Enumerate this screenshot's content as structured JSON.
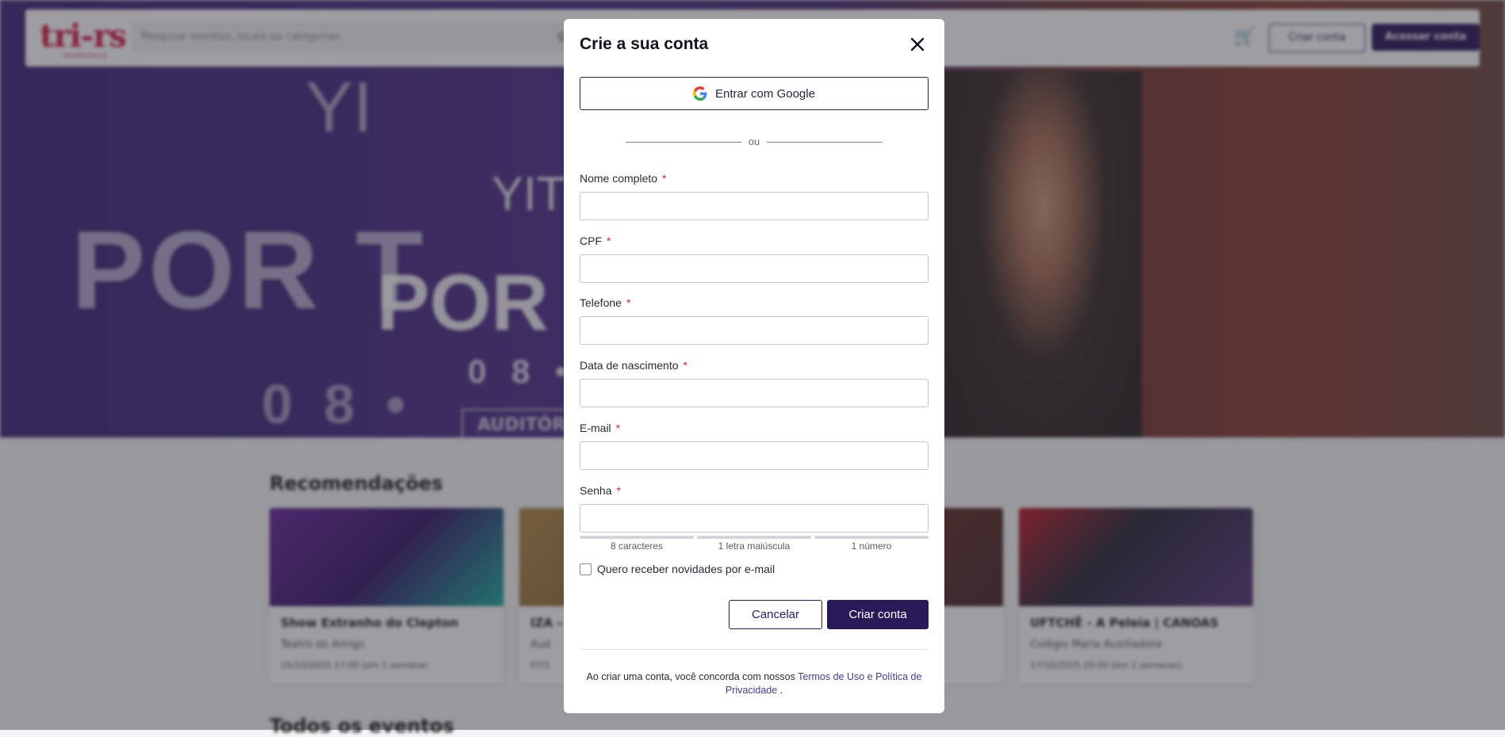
{
  "background": {
    "header": {
      "logo": "tri-rs",
      "logo_sub": "INGRESSOS",
      "search_placeholder": "Pesquise eventos, locais ou categorias",
      "create_account_label": "Criar conta",
      "login_label": "Acessar conta"
    },
    "hero": {
      "line_top": "YI",
      "line_artist": "YITO",
      "big_text": "POR T",
      "mid_text": "POR TO",
      "date_big": "0 8 •",
      "date_mid": "0 8 • C",
      "venue_button": "AUDITÓR"
    },
    "recommendations_title": "Recomendações",
    "cards": [
      {
        "title": "Show Extranho do Clepton",
        "place": "Teatro do Amigo",
        "date": "15/10/2025 17:00 (em 1 semana)"
      },
      {
        "title": "IZA –",
        "place": "Aud",
        "date": "07/1"
      },
      {
        "title": "",
        "place": "",
        "date": ""
      },
      {
        "title": "UFTCHÊ - A Peleia | CANOAS",
        "place": "Colégio Maria Auxiliadora",
        "date": "17/10/2025 20:00 (em 2 semanas)"
      }
    ],
    "all_events_title": "Todos os eventos"
  },
  "modal": {
    "title": "Crie a sua conta",
    "google_label": "Entrar com Google",
    "divider_text": "ou",
    "fields": [
      {
        "label": "Nome completo",
        "required_mark": "*",
        "value": ""
      },
      {
        "label": "CPF",
        "required_mark": "*",
        "value": ""
      },
      {
        "label": "Telefone",
        "required_mark": "*",
        "value": ""
      },
      {
        "label": "Data de nascimento",
        "required_mark": "*",
        "value": ""
      },
      {
        "label": "E-mail",
        "required_mark": "*",
        "value": ""
      },
      {
        "label": "Senha",
        "required_mark": "*",
        "value": ""
      }
    ],
    "password_hints": [
      "8 caracteres",
      "1 letra maiúscula",
      "1 número"
    ],
    "newsletter_label": "Quero receber novidades por e-mail",
    "cancel_label": "Cancelar",
    "submit_label": "Criar conta",
    "terms_prefix": "Ao criar uma conta, você concorda com nossos ",
    "terms_link": "Termos de Uso e Política de Privacidade",
    "terms_suffix": " ."
  },
  "colors": {
    "primary": "#2b1a5a",
    "required": "#d3263c",
    "link": "#4b3a8c",
    "brand": "#d31f4b"
  }
}
